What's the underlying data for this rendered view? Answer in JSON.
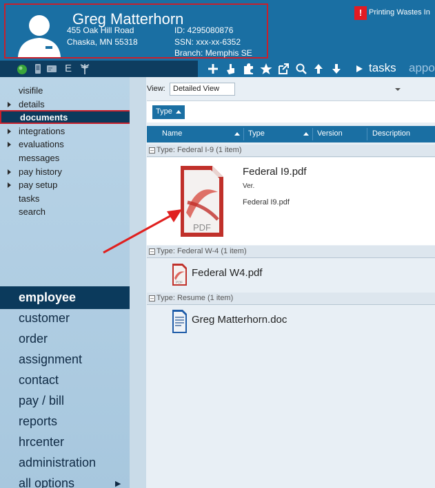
{
  "employee": {
    "name": "Greg Matterhorn",
    "address1": "455 Oak Hill Road",
    "address2": "Chaska, MN 55318",
    "id": "ID: 4295080876",
    "ssn": "SSN: xxx-xx-6352",
    "branch": "Branch:  Memphis SE"
  },
  "alert": {
    "icon": "!",
    "text": "Printing Wastes In"
  },
  "toolbar": {
    "left_icons": [
      "status-green-icon",
      "phone-icon",
      "card-icon",
      "e-icon",
      "caduceus-icon"
    ],
    "e_label": "E",
    "right_icons": [
      "plus-icon",
      "hand-pointer-icon",
      "puzzle-icon",
      "star-icon",
      "external-link-icon",
      "search-icon",
      "arrow-up-icon",
      "arrow-down-icon"
    ],
    "tasks_label": "tasks",
    "appo_label": "appo"
  },
  "sidebar": {
    "sub_items": [
      {
        "label": "visifile",
        "arrow": false
      },
      {
        "label": "details",
        "arrow": true
      },
      {
        "label": "documents",
        "arrow": false,
        "selected": true
      },
      {
        "label": "integrations",
        "arrow": true
      },
      {
        "label": "evaluations",
        "arrow": true
      },
      {
        "label": "messages",
        "arrow": false
      },
      {
        "label": "pay history",
        "arrow": true
      },
      {
        "label": "pay setup",
        "arrow": true
      },
      {
        "label": "tasks",
        "arrow": false
      },
      {
        "label": "search",
        "arrow": false
      }
    ],
    "main_nav": [
      "employee",
      "customer",
      "order",
      "assignment",
      "contact",
      "pay / bill",
      "reports",
      "hrcenter",
      "administration",
      "all options"
    ],
    "more_arrow": "▶"
  },
  "view": {
    "label": "View:",
    "value": "Detailed View"
  },
  "group_button": "Type",
  "columns": [
    "Name",
    "Type",
    "Version",
    "Description"
  ],
  "groups": [
    {
      "header": "Type: Federal I-9 (1 item)",
      "doc": {
        "name": "Federal I9.pdf",
        "version": "Ver.",
        "filename": "Federal I9.pdf",
        "icon": "pdf-icon"
      }
    },
    {
      "header": "Type: Federal W-4 (1 item)",
      "doc": {
        "name": "Federal W4.pdf",
        "icon": "pdf-icon"
      }
    },
    {
      "header": "Type: Resume (1 item)",
      "doc": {
        "name": "Greg Matterhorn.doc",
        "icon": "doc-icon"
      }
    }
  ],
  "colors": {
    "header_blue": "#1a6fa3",
    "navy": "#0b3a5c",
    "highlight_red": "#c8202c",
    "pdf_red": "#c0302a"
  }
}
